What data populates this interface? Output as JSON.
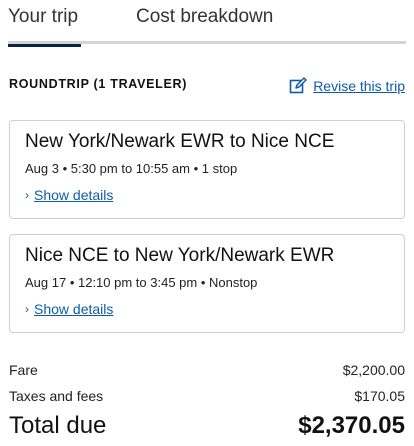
{
  "tabs": [
    {
      "label": "Your trip",
      "active": true
    },
    {
      "label": "Cost breakdown",
      "active": false
    }
  ],
  "trip": {
    "header": "ROUNDTRIP (1 TRAVELER)",
    "revise_label": "Revise this trip",
    "revise_icon": "edit-icon"
  },
  "flights": [
    {
      "title": "New York/Newark EWR to Nice NCE",
      "subtitle": "Aug 3 • 5:30 pm to 10:55 am • 1 stop",
      "details_label": "Show details"
    },
    {
      "title": "Nice NCE to New York/Newark EWR",
      "subtitle": "Aug 17 • 12:10 pm to 3:45 pm • Nonstop",
      "details_label": "Show details"
    }
  ],
  "pricing": {
    "fare_label": "Fare",
    "fare_value": "$2,200.00",
    "taxes_label": "Taxes and fees",
    "taxes_value": "$170.05",
    "total_label": "Total due",
    "total_value": "$2,370.05"
  },
  "colors": {
    "link": "#0c5ca8",
    "active_tab_underline": "#0c2340",
    "border": "#cfcfcf"
  }
}
